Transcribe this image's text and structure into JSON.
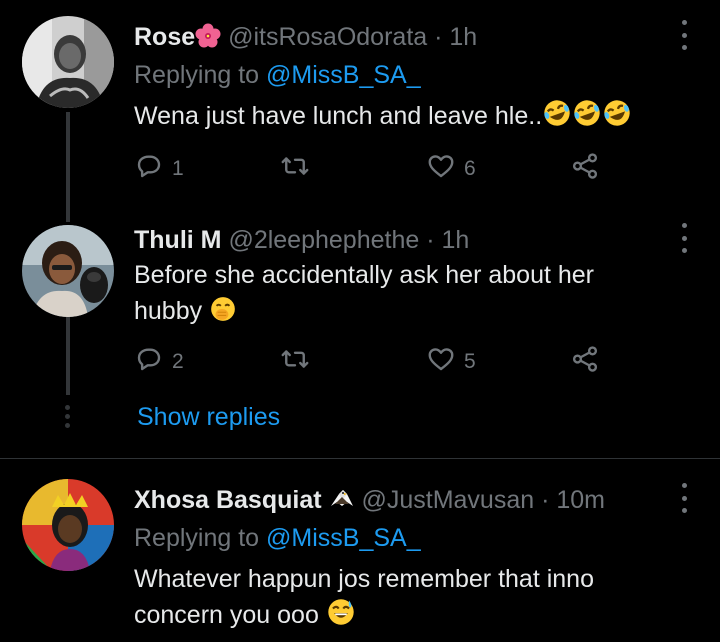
{
  "tweets": [
    {
      "name": "Rose",
      "handle": "@itsRosaOdorata",
      "sep": " · ",
      "time": "1h",
      "replying_prefix": "Replying to ",
      "replying_handle": "@MissB_SA_",
      "text": "Wena just have lunch and leave hle..",
      "reply_count": "1",
      "retweet_count": "",
      "like_count": "6"
    },
    {
      "name": "Thuli M",
      "handle": "@2leephephethe",
      "sep": " · ",
      "time": "1h",
      "text_line1": "Before she accidentally ask her about her",
      "text_line2": "hubby",
      "reply_count": "2",
      "retweet_count": "",
      "like_count": "5",
      "show_replies": "Show replies"
    },
    {
      "name": "Xhosa Basquiat",
      "handle": "@JustMavusan",
      "sep": " · ",
      "time": "10m",
      "replying_prefix": "Replying to ",
      "replying_handle": "@MissB_SA_",
      "text_line1": "Whatever happun jos remember that inno",
      "text_line2": "concern you ooo"
    }
  ],
  "icons": {
    "reply": "reply-icon",
    "retweet": "retweet-icon",
    "like": "heart-icon",
    "share": "share-icon",
    "more": "more-vertical-icon"
  },
  "colors": {
    "background": "#000000",
    "text": "#e7e9ea",
    "muted": "#71767b",
    "link": "#1d9bf0",
    "line": "#333639"
  }
}
